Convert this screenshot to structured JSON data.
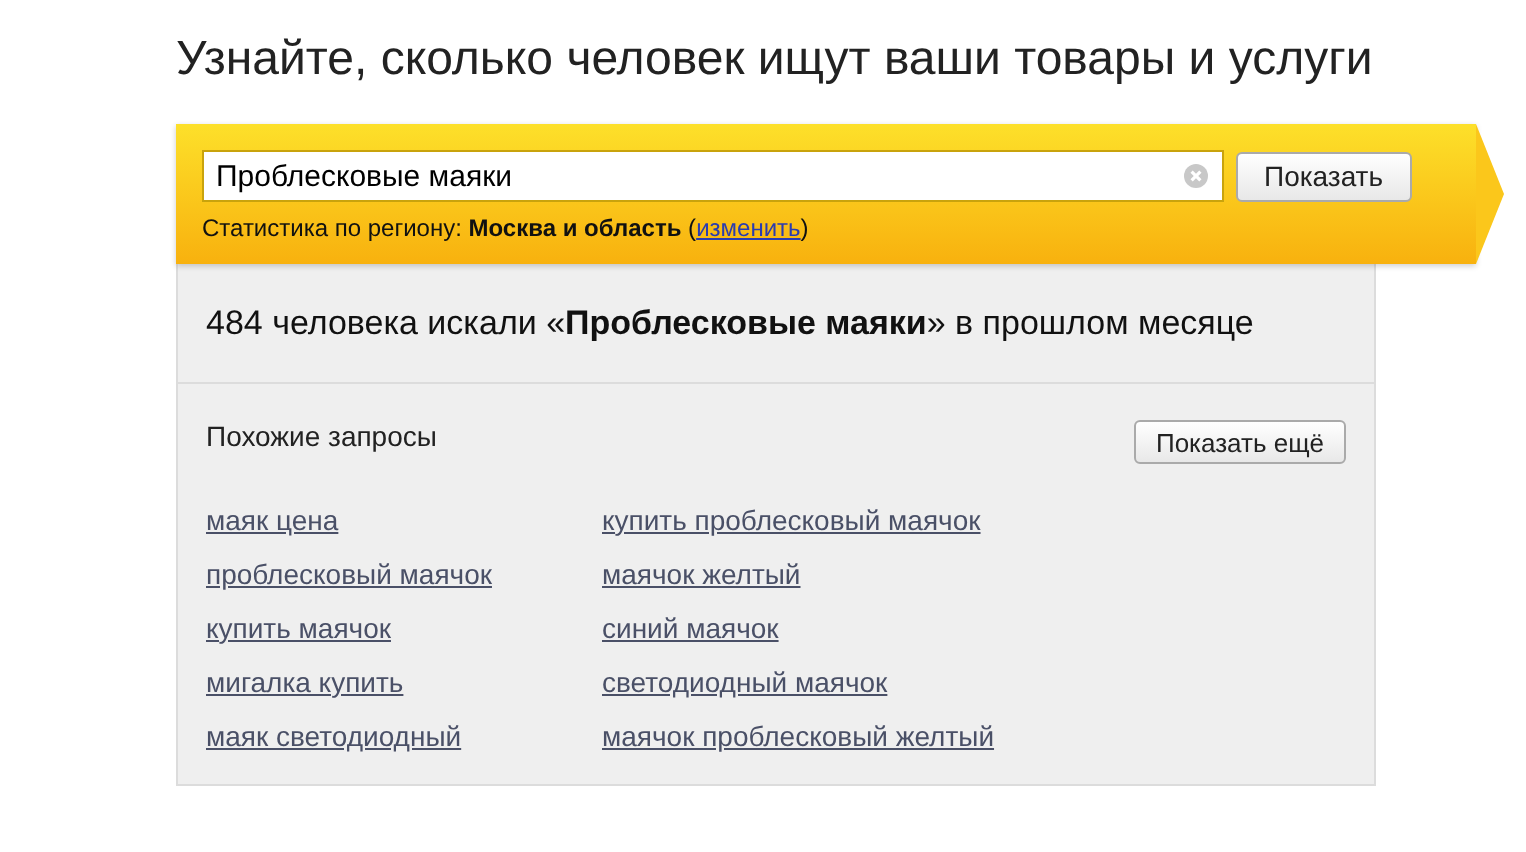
{
  "title": "Узнайте, сколько человек ищут ваши товары и услуги",
  "search": {
    "value": "Проблесковые маяки",
    "button": "Показать"
  },
  "region": {
    "before": "Статистика по региону: **Москва и область** (",
    "link": "изменить",
    "after": ")"
  },
  "result": "484 человека искали «**Проблесковые маяки**» в прошлом месяце",
  "similar": {
    "heading": "Похожие запросы",
    "more_button": "Показать ещё",
    "columns": [
      [
        "маяк цена",
        "проблесковый маячок",
        "купить маячок",
        "мигалка купить",
        "маяк светодиодный"
      ],
      [
        "купить проблесковый маячок",
        "маячок желтый",
        "синий маячок",
        "светодиодный маячок",
        "маячок проблесковый желтый"
      ]
    ]
  }
}
